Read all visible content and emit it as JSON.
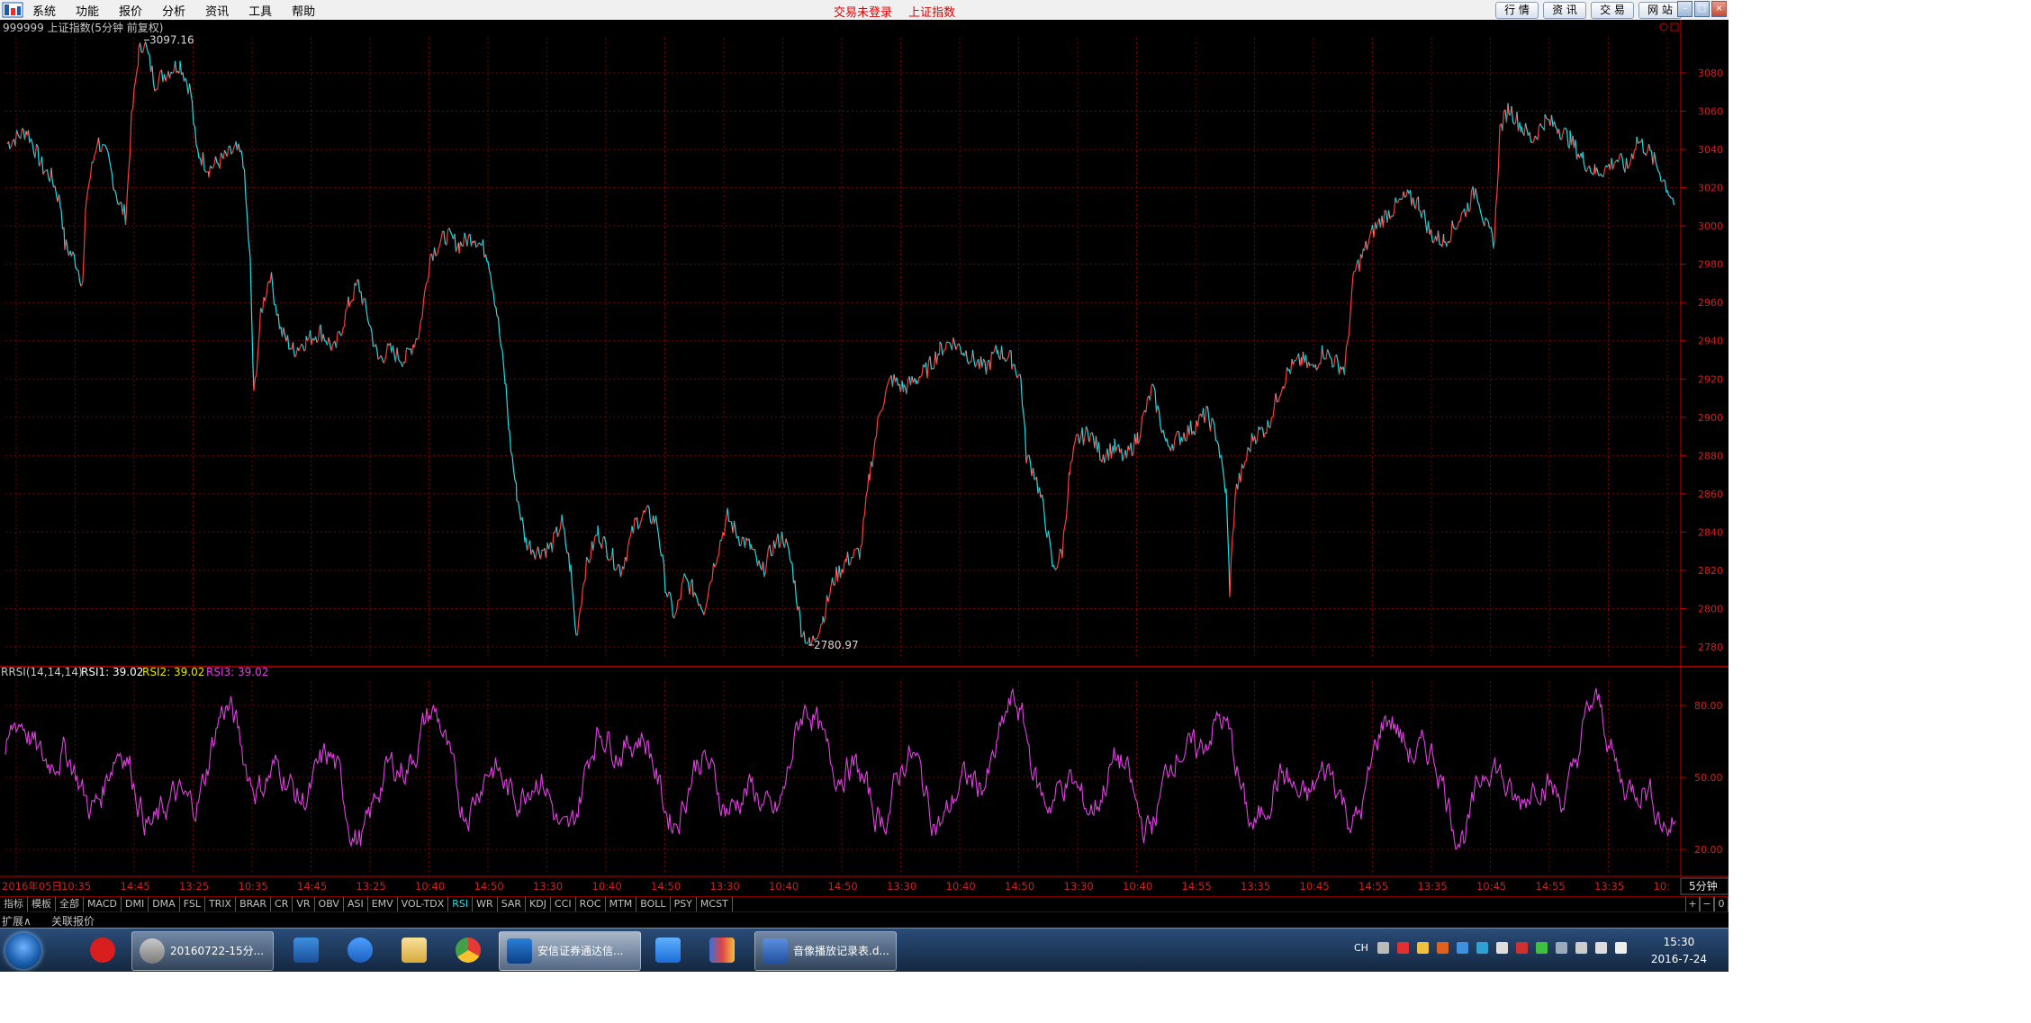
{
  "menubar": {
    "items": [
      "系统",
      "功能",
      "报价",
      "分析",
      "资讯",
      "工具",
      "帮助"
    ],
    "status_left": "交易未登录",
    "status_right": "上证指数",
    "right_buttons": [
      "行 情",
      "资 讯",
      "交 易",
      "网 站"
    ]
  },
  "main_chart": {
    "header": "999999 上证指数(5分钟 前复权)",
    "max_label": "3097.16",
    "min_label": "2780.97",
    "y_ticks": [
      "3080",
      "3060",
      "3040",
      "3020",
      "3000",
      "2980",
      "2960",
      "2940",
      "2920",
      "2900",
      "2880",
      "2860",
      "2840",
      "2820",
      "2800",
      "2780"
    ]
  },
  "sub_chart": {
    "header_name": "RSI(14,14,14)",
    "rsi1": "RSI1: 39.02",
    "rsi2": "RSI2: 39.02",
    "rsi3": "RSI3: 39.02",
    "y_ticks": [
      "80.00",
      "50.00",
      "20.00"
    ]
  },
  "time_axis": {
    "labels": [
      "2016年05日",
      "10:35",
      "14:45",
      "13:25",
      "10:35",
      "14:45",
      "13:25",
      "10:40",
      "14:50",
      "13:30",
      "10:40",
      "14:50",
      "13:30",
      "10:40",
      "14:50",
      "13:30",
      "10:40",
      "14:50",
      "13:30",
      "10:40",
      "14:55",
      "13:35",
      "10:45",
      "14:55",
      "13:35",
      "10:45",
      "14:55",
      "13:35",
      "10:"
    ],
    "period": "5分钟"
  },
  "indicator_tabs": [
    "指标",
    "模板",
    "全部",
    "MACD",
    "DMI",
    "DMA",
    "FSL",
    "TRIX",
    "BRAR",
    "CR",
    "VR",
    "OBV",
    "ASI",
    "EMV",
    "VOL-TDX",
    "RSI",
    "WR",
    "SAR",
    "KDJ",
    "CCI",
    "ROC",
    "MTM",
    "BOLL",
    "PSY",
    "MCST"
  ],
  "selected_tab": "RSI",
  "bottom": {
    "expand": "扩展∧",
    "related": "关联报价"
  },
  "taskbar": {
    "windows": [
      "20160722-15分...",
      "安信证券通达信...",
      "音像播放记录表.d..."
    ],
    "lang": "CH",
    "time": "15:30",
    "date": "2016-7-24"
  },
  "colors": {
    "up": "#ff3a3a",
    "down": "#1ae0e6",
    "rsi": "#e040e0",
    "grid": "#7a0000",
    "axis": "#c40000"
  }
}
